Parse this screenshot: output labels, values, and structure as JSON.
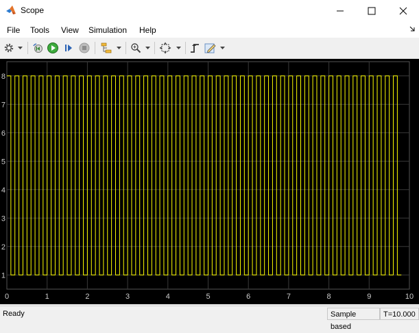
{
  "window": {
    "title": "Scope"
  },
  "menu": [
    "File",
    "Tools",
    "View",
    "Simulation",
    "Help"
  ],
  "status": {
    "ready": "Ready",
    "mode": "Sample based",
    "time": "T=10.000"
  },
  "colors": {
    "trace": "#ffff00",
    "background": "#000000",
    "grid": "#3a3a3a",
    "axis_text": "#cccccc"
  },
  "chart_data": {
    "type": "line",
    "title": "",
    "xlabel": "",
    "ylabel": "",
    "xlim": [
      0,
      10
    ],
    "ylim": [
      0.5,
      8.5
    ],
    "grid": true,
    "xticks": [
      0,
      1,
      2,
      3,
      4,
      5,
      6,
      7,
      8,
      9,
      10
    ],
    "yticks": [
      1,
      2,
      3,
      4,
      5,
      6,
      7,
      8
    ],
    "series": [
      {
        "signal": "square wave",
        "period": 0.2,
        "duty": 0.5,
        "high": 8,
        "low": 1,
        "x_start": 0,
        "x_end": 9.8
      }
    ]
  }
}
